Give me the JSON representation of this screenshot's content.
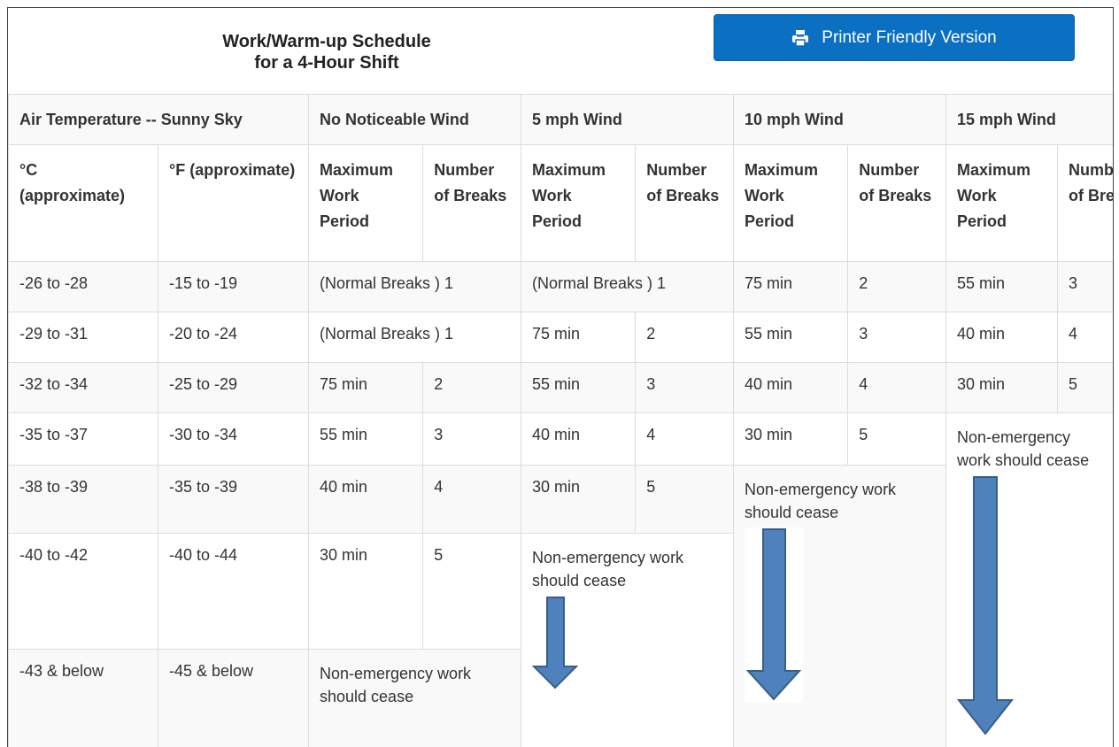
{
  "title": {
    "line1": "Work/Warm-up Schedule",
    "line2": "for a 4-Hour Shift"
  },
  "print_button": {
    "label": "Printer Friendly Version",
    "icon": "printer-icon",
    "color": "#0b6fc2"
  },
  "table": {
    "group_headers": [
      "Air Temperature -- Sunny Sky",
      "No Noticeable Wind",
      "5 mph Wind",
      "10 mph Wind",
      "15 mph Wind"
    ],
    "sub_headers": {
      "c": "°C (approximate)",
      "f": "°F (approximate)",
      "max_work": "Maximum Work Period",
      "breaks": "Number of Breaks",
      "breaks_cut": "Number of Breaks"
    },
    "rows": [
      {
        "c": "-26 to -28",
        "f": "-15 to -19",
        "nw": "(Normal Breaks ) 1",
        "w5": "(Normal Breaks ) 1",
        "w10_max": "75 min",
        "w10_br": "2",
        "w15_max": "55 min",
        "w15_br": "3"
      },
      {
        "c": "-29 to -31",
        "f": "-20 to -24",
        "nw": "(Normal Breaks ) 1",
        "w5_max": "75 min",
        "w5_br": "2",
        "w10_max": "55 min",
        "w10_br": "3",
        "w15_max": "40 min",
        "w15_br": "4"
      },
      {
        "c": "-32 to -34",
        "f": "-25 to -29",
        "nw_max": "75 min",
        "nw_br": "2",
        "w5_max": "55 min",
        "w5_br": "3",
        "w10_max": "40 min",
        "w10_br": "4",
        "w15_max": "30 min",
        "w15_br": "5"
      },
      {
        "c": "-35 to -37",
        "f": "-30 to -34",
        "nw_max": "55 min",
        "nw_br": "3",
        "w5_max": "40 min",
        "w5_br": "4",
        "w10_max": "30 min",
        "w10_br": "5"
      },
      {
        "c": "-38 to -39",
        "f": "-35 to -39",
        "nw_max": "40 min",
        "nw_br": "4",
        "w5_max": "30 min",
        "w5_br": "5"
      },
      {
        "c": "-40 to -42",
        "f": "-40 to -44",
        "nw_max": "30 min",
        "nw_br": "5"
      },
      {
        "c": "-43 & below",
        "f": "-45 & below"
      }
    ],
    "cease_text": "Non-emergency work should cease"
  },
  "colors": {
    "arrow_fill": "#4f81bd",
    "arrow_stroke": "#385d8a"
  }
}
